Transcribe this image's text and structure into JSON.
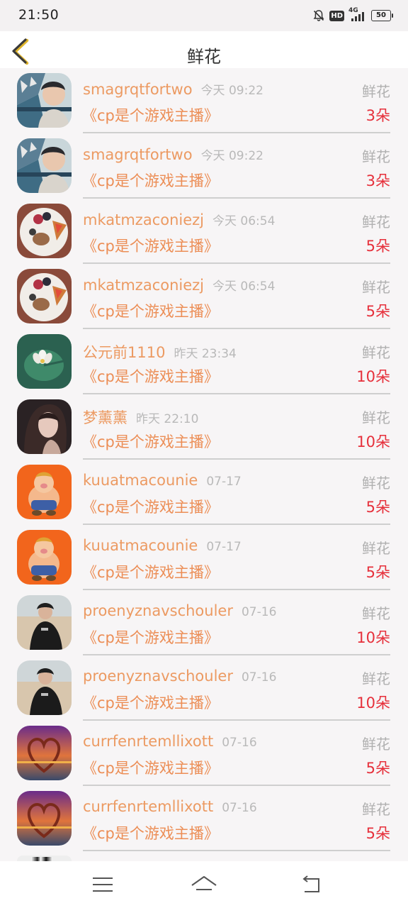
{
  "status_bar": {
    "time": "21:50",
    "hd_label": "HD",
    "network_label": "4G",
    "battery_level": "50",
    "icons": [
      "bell-muted-icon",
      "hd-icon",
      "signal-icon",
      "battery-icon"
    ]
  },
  "header": {
    "title": "鲜花",
    "back_icon": "chevron-left-icon",
    "accent_color": "#e0b52b"
  },
  "records": [
    {
      "user": "smagrqtfortwo",
      "time": "今天 09:22",
      "gift": "鲜花",
      "room": "《cp是个游戏主播》",
      "count": "3朵",
      "avatar": "boy-portrait"
    },
    {
      "user": "smagrqtfortwo",
      "time": "今天 09:22",
      "gift": "鲜花",
      "room": "《cp是个游戏主播》",
      "count": "3朵",
      "avatar": "boy-portrait"
    },
    {
      "user": "mkatmzaconiezj",
      "time": "今天 06:54",
      "gift": "鲜花",
      "room": "《cp是个游戏主播》",
      "count": "5朵",
      "avatar": "food-plate"
    },
    {
      "user": "mkatmzaconiezj",
      "time": "今天 06:54",
      "gift": "鲜花",
      "room": "《cp是个游戏主播》",
      "count": "5朵",
      "avatar": "food-plate"
    },
    {
      "user": "公元前1110",
      "time": "昨天 23:34",
      "gift": "鲜花",
      "room": "《cp是个游戏主播》",
      "count": "10朵",
      "avatar": "lotus-leaf"
    },
    {
      "user": "梦薰薰",
      "time": "昨天 22:10",
      "gift": "鲜花",
      "room": "《cp是个游戏主播》",
      "count": "10朵",
      "avatar": "woman-portrait"
    },
    {
      "user": "kuuatmacounie",
      "time": "07-17",
      "gift": "鲜花",
      "room": "《cp是个游戏主播》",
      "count": "5朵",
      "avatar": "cartoon-pig"
    },
    {
      "user": "kuuatmacounie",
      "time": "07-17",
      "gift": "鲜花",
      "room": "《cp是个游戏主播》",
      "count": "5朵",
      "avatar": "cartoon-pig"
    },
    {
      "user": "proenyznavschouler",
      "time": "07-16",
      "gift": "鲜花",
      "room": "《cp是个游戏主播》",
      "count": "10朵",
      "avatar": "beach-girl"
    },
    {
      "user": "proenyznavschouler",
      "time": "07-16",
      "gift": "鲜花",
      "room": "《cp是个游戏主播》",
      "count": "10朵",
      "avatar": "beach-girl"
    },
    {
      "user": "currfenrtemllixott",
      "time": "07-16",
      "gift": "鲜花",
      "room": "《cp是个游戏主播》",
      "count": "5朵",
      "avatar": "heart-sunset"
    },
    {
      "user": "currfenrtemllixott",
      "time": "07-16",
      "gift": "鲜花",
      "room": "《cp是个游戏主播》",
      "count": "5朵",
      "avatar": "heart-sunset"
    }
  ],
  "bottom_nav": {
    "icons": [
      "menu-icon",
      "home-icon",
      "back-icon"
    ]
  },
  "colors": {
    "username": "#ec9a62",
    "timestamp": "#b9b9b9",
    "gift_label": "#b0b0b0",
    "count": "#e6303b",
    "divider": "#cfcfcf"
  }
}
